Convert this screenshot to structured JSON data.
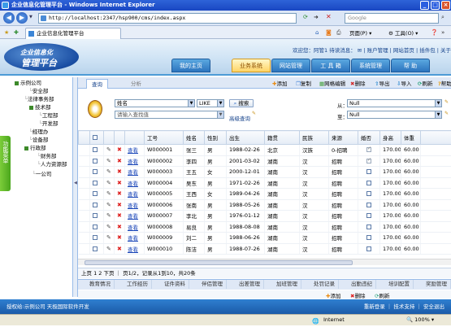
{
  "window": {
    "title": "企业信息化管理平台 - Windows Internet Explorer",
    "url": "http://localhost:2347/hsp900/cms/index.aspx",
    "search_placeholder": "Google",
    "tab_title": "企业信息化管理平台",
    "commands": [
      "页面(P)",
      "工具(O)"
    ],
    "status_zone": "Internet",
    "zoom": "100%"
  },
  "header": {
    "logo_line1": "企业信息化",
    "logo_line2": "管理平台",
    "welcome": "欢迎您：阿管1 待读消息：",
    "links": [
      "账户管理",
      "网站首页",
      "插件包",
      "关于"
    ],
    "main_tabs": [
      "我的主页",
      "业务系统",
      "网站管理",
      "工 具 箱",
      "系统管理",
      "帮 助"
    ],
    "active_tab": 1
  },
  "sidebar": {
    "tab_label": "功能菜单",
    "tree": [
      {
        "label": "示例公司",
        "level": 0
      },
      {
        "label": "安全部",
        "level": 2
      },
      {
        "label": "法律事务部",
        "level": 2
      },
      {
        "label": "技术部",
        "level": 1
      },
      {
        "label": "工程部",
        "level": 3
      },
      {
        "label": "开发部",
        "level": 3
      },
      {
        "label": "经理办",
        "level": 2
      },
      {
        "label": "设备部",
        "level": 2
      },
      {
        "label": "行政部",
        "level": 1
      },
      {
        "label": "财务部",
        "level": 3
      },
      {
        "label": "人力资源部",
        "level": 3
      },
      {
        "label": "一公司",
        "level": 2
      }
    ]
  },
  "content": {
    "tabs": [
      "查询",
      "分析"
    ],
    "toolbar": [
      "添加",
      "复制",
      "网格编辑",
      "删除",
      "导出",
      "导入",
      "刷新",
      "帮助"
    ],
    "toolbar_colors": [
      "#e88b14",
      "#2a6fd1",
      "#3c9a36",
      "#d22b2b",
      "#2f8bd1",
      "#2f8bd1",
      "#28a37a",
      "#e8a114"
    ],
    "query": {
      "field": "姓名",
      "operator": "LIKE",
      "search_button": "搜索",
      "input_placeholder": "请输入查找值",
      "advanced": "高级查询",
      "from_label": "从：",
      "to_label": "至：",
      "from_value": "Null",
      "to_value": "Null"
    },
    "grid": {
      "columns": [
        "",
        "",
        "",
        "",
        "工号",
        "姓名",
        "性别",
        "出生",
        "籍贯",
        "民族",
        "来源",
        "婚否",
        "身高",
        "体重",
        ""
      ],
      "view_label": "查看",
      "rows": [
        {
          "id": "W000001",
          "name": "张三",
          "sex": "男",
          "birth": "1988-02-26",
          "origin": "北京",
          "nation": "汉族",
          "source": "0-招聘",
          "married": true,
          "height": "170.00",
          "weight": "60.00"
        },
        {
          "id": "W000002",
          "name": "李四",
          "sex": "男",
          "birth": "2001-03-02",
          "origin": "湖南",
          "nation": "汉",
          "source": "招聘",
          "married": true,
          "height": "170.00",
          "weight": "60.00"
        },
        {
          "id": "W000003",
          "name": "王五",
          "sex": "女",
          "birth": "2000-12-01",
          "origin": "湖南",
          "nation": "汉",
          "source": "招聘",
          "married": false,
          "height": "170.00",
          "weight": "60.00"
        },
        {
          "id": "W000004",
          "name": "吴东",
          "sex": "男",
          "birth": "1971-02-26",
          "origin": "湖南",
          "nation": "汉",
          "source": "招聘",
          "married": false,
          "height": "170.00",
          "weight": "60.00"
        },
        {
          "id": "W000005",
          "name": "王西",
          "sex": "女",
          "birth": "1989-04-26",
          "origin": "湖南",
          "nation": "汉",
          "source": "招聘",
          "married": false,
          "height": "170.00",
          "weight": "60.00"
        },
        {
          "id": "W000006",
          "name": "张南",
          "sex": "男",
          "birth": "1988-05-26",
          "origin": "湖南",
          "nation": "汉",
          "source": "招聘",
          "married": false,
          "height": "170.00",
          "weight": "60.00"
        },
        {
          "id": "W000007",
          "name": "李北",
          "sex": "男",
          "birth": "1976-01-12",
          "origin": "湖南",
          "nation": "汉",
          "source": "招聘",
          "married": false,
          "height": "170.00",
          "weight": "60.00"
        },
        {
          "id": "W000008",
          "name": "易良",
          "sex": "男",
          "birth": "1988-08-08",
          "origin": "湖南",
          "nation": "汉",
          "source": "招聘",
          "married": false,
          "height": "170.00",
          "weight": "60.00"
        },
        {
          "id": "W000009",
          "name": "刘二",
          "sex": "男",
          "birth": "1988-06-26",
          "origin": "湖南",
          "nation": "汉",
          "source": "招聘",
          "married": false,
          "height": "170.00",
          "weight": "60.00"
        },
        {
          "id": "W000010",
          "name": "陈洁",
          "sex": "男",
          "birth": "1988-07-26",
          "origin": "湖南",
          "nation": "汉",
          "source": "招聘",
          "married": false,
          "height": "170.00",
          "weight": "60.00"
        }
      ]
    },
    "pager": "上页 1 2 下页 ｜ 页1/2，记录从1到10，共20条",
    "bottom_tabs": [
      "教育情况",
      "工作经历",
      "证件资料",
      "伴侣管理",
      "出差管理",
      "加班管理",
      "处罚记录",
      "出勤违纪",
      "培训配置",
      "奖励管理"
    ],
    "sub_toolbar": [
      "添加",
      "删除",
      "刷新"
    ]
  },
  "footer": {
    "left": "授权给:示例公司 天极国际软件开发",
    "right": "重新登录 ｜ 技术支持 ｜ 安全退出"
  }
}
